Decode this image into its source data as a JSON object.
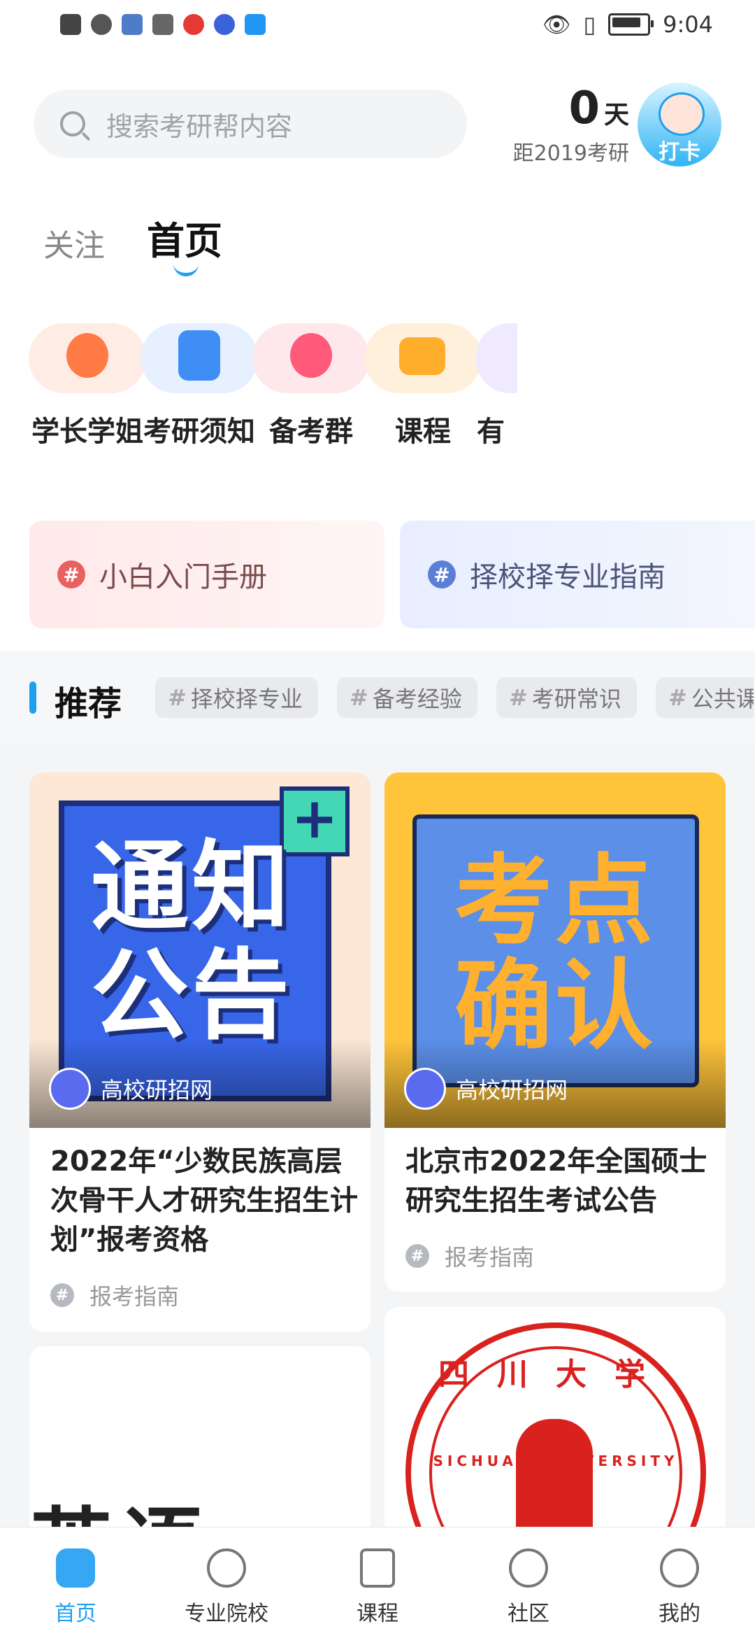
{
  "status_bar": {
    "time": "9:04"
  },
  "header": {
    "search_placeholder": "搜索考研帮内容",
    "countdown_number": "0",
    "countdown_unit": "天",
    "countdown_label": "距2019考研",
    "punch_label": "打卡"
  },
  "tabs": {
    "follow": "关注",
    "home": "首页"
  },
  "quick_icons": [
    {
      "label": "学长学姐",
      "icon": "graduate-cap-icon",
      "color": "#ff7a45"
    },
    {
      "label": "考研须知",
      "icon": "document-icon",
      "color": "#3f8ef5"
    },
    {
      "label": "备考群",
      "icon": "group-icon",
      "color": "#ff5a7a"
    },
    {
      "label": "课程",
      "icon": "video-camera-icon",
      "color": "#ffae2c"
    },
    {
      "label": "有",
      "icon": "more-icon",
      "color": "#b9a8ff"
    }
  ],
  "guides": [
    {
      "label": "小白入门手册",
      "color": "#e96060"
    },
    {
      "label": "择校择专业指南",
      "color": "#5b7fd6"
    }
  ],
  "recommend": {
    "title": "推荐",
    "chips": [
      "择校择专业",
      "备考经验",
      "考研常识",
      "公共课"
    ]
  },
  "feed": {
    "card1": {
      "cover_text_1": "通知",
      "cover_text_2": "公告",
      "source": "高校研招网",
      "title": "2022年“少数民族高层次骨干人才研究生招生计划”报考资格",
      "tag": "报考指南"
    },
    "card2": {
      "cover_text_1": "考点",
      "cover_text_2": "确认",
      "source": "高校研招网",
      "title": "北京市2022年全国硕士研究生招生考试公告",
      "tag": "报考指南"
    },
    "card3": {
      "cover_text": "英语"
    },
    "card4": {
      "seal_text": "四川大学",
      "seal_text_en": "SICHUAN UNIVERSITY"
    }
  },
  "bottom_nav": [
    {
      "label": "首页",
      "active": true
    },
    {
      "label": "专业院校",
      "active": false
    },
    {
      "label": "课程",
      "active": false
    },
    {
      "label": "社区",
      "active": false
    },
    {
      "label": "我的",
      "active": false
    }
  ]
}
